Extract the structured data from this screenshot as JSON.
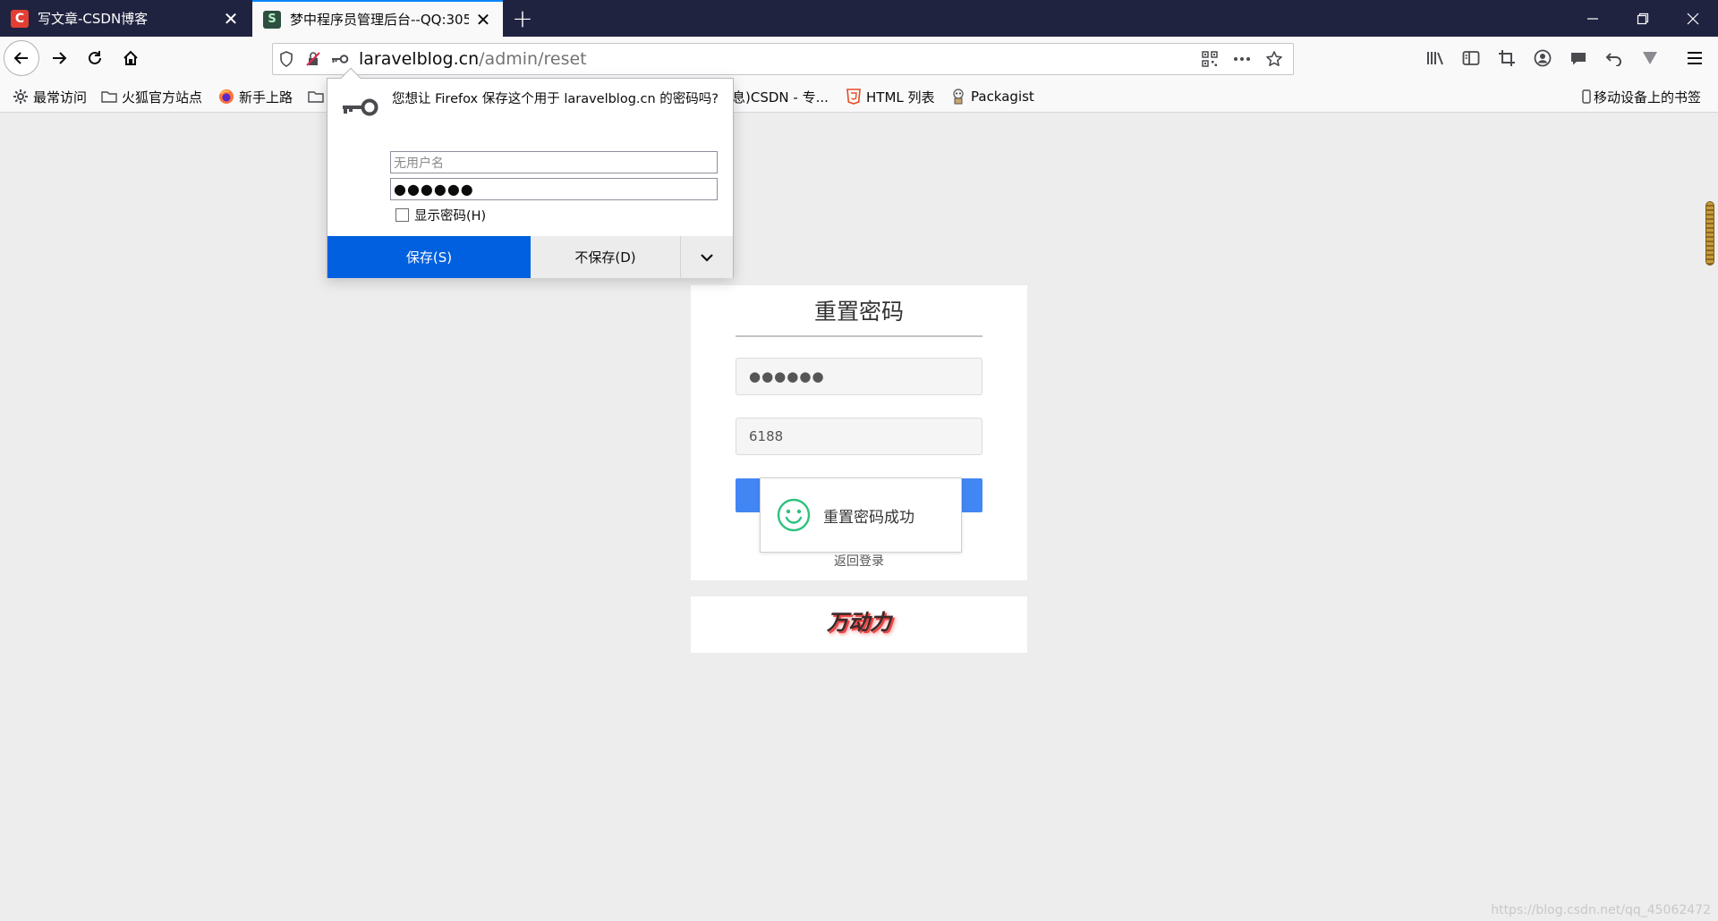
{
  "tabs": [
    {
      "favicon": "C",
      "label": "写文章-CSDN博客",
      "active": false
    },
    {
      "favicon": "S",
      "label": "梦中程序员管理后台--QQ:305",
      "active": true
    }
  ],
  "window_controls": [
    "minimize-icon",
    "restore-icon",
    "close-icon"
  ],
  "urlbar": {
    "host": "laravelblog.cn",
    "path": "/admin/reset"
  },
  "bookmarks": [
    {
      "label": "最常访问",
      "icon": "gear-icon"
    },
    {
      "label": "火狐官方站点",
      "icon": "folder-icon"
    },
    {
      "label": "新手上路",
      "icon": "firefox-icon"
    },
    {
      "label": "",
      "icon": "folder-icon"
    },
    {
      "label": "息)CSDN - 专...",
      "icon": "none"
    },
    {
      "label": "HTML 列表",
      "icon": "html5-icon"
    },
    {
      "label": "Packagist",
      "icon": "packagist-icon"
    }
  ],
  "mobile_bookmarks": "移动设备上的书签",
  "password_prompt": {
    "message": "您想让 Firefox 保存这个用于 laravelblog.cn 的密码吗?",
    "username_placeholder": "无用户名",
    "password_masked": "●●●●●●",
    "show_password_label": "显示密码(H)",
    "save_label": "保存(S)",
    "dont_save_label": "不保存(D)"
  },
  "reset_form": {
    "title": "重置密码",
    "password_masked": "●●●●●●",
    "code_value": "6188",
    "back_link_text": "返回登录"
  },
  "toast": {
    "message": "重置密码成功"
  },
  "brand": {
    "text": "万动力"
  },
  "watermark": "https://blog.csdn.net/qq_45062472",
  "colors": {
    "tab_bar": "#202340",
    "save_button": "#0060df",
    "primary_button": "#4286f4",
    "toast_icon": "#2ec27e"
  }
}
